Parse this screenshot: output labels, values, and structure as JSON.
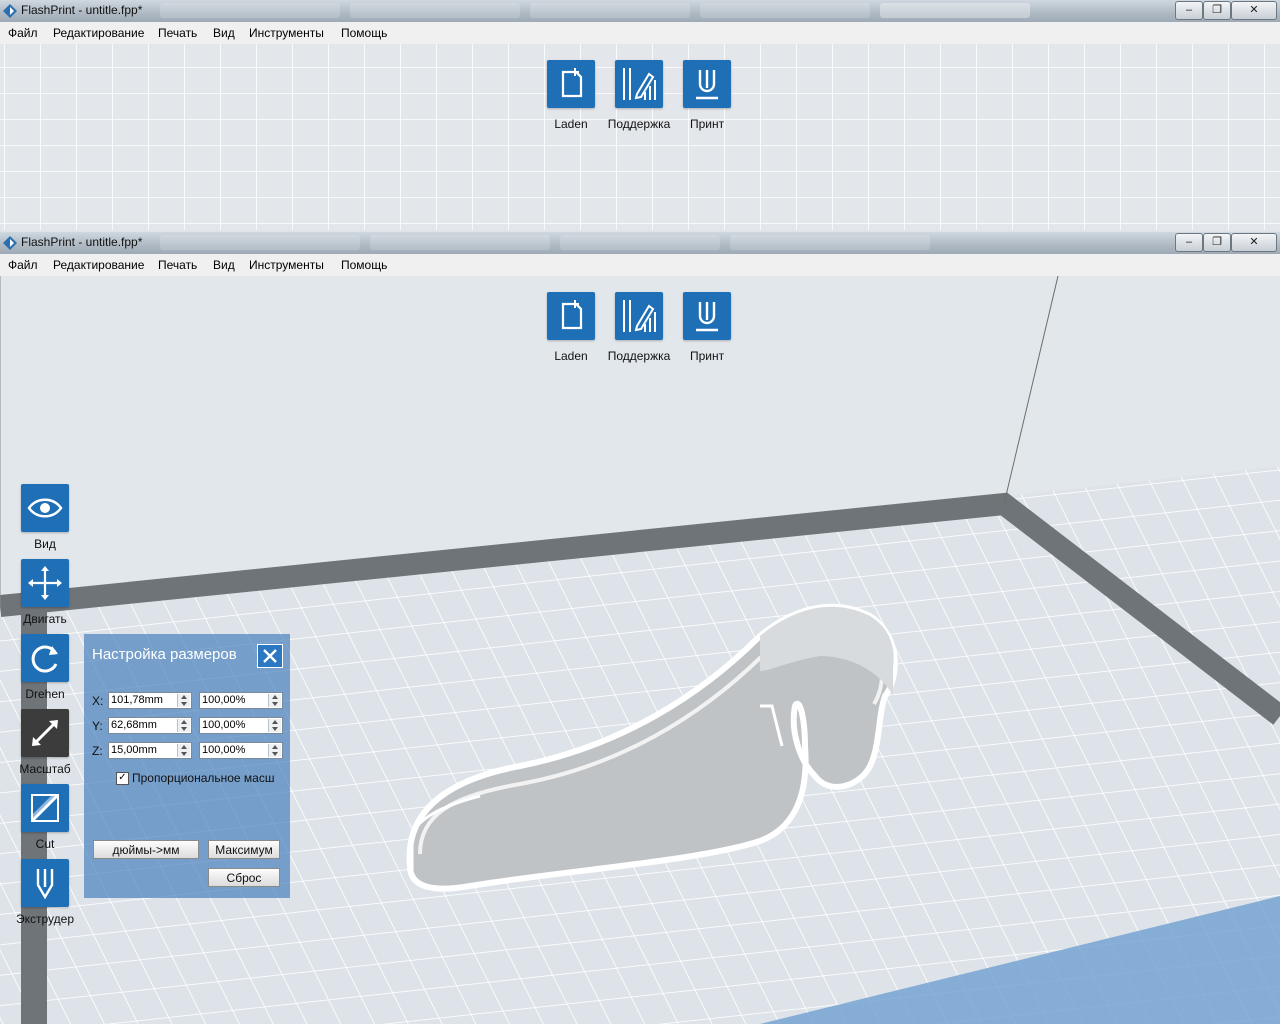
{
  "app": {
    "title": "FlashPrint - untitle.fpp*"
  },
  "window_controls": {
    "minimize": "–",
    "restore": "❐",
    "close": "✕"
  },
  "menu": [
    "Файл",
    "Редактирование",
    "Печать",
    "Вид",
    "Инструменты",
    "Помощь"
  ],
  "toolbar": {
    "load": "Laden",
    "support": "Поддержка",
    "print": "Принт"
  },
  "left_tools": {
    "view": "Вид",
    "move": "Двигать",
    "rotate": "Drehen",
    "scale": "Масштаб",
    "cut": "Cut",
    "extruder": "Экструдер"
  },
  "scale_panel": {
    "title": "Настройка размеров",
    "rows": [
      {
        "axis": "X:",
        "size": "101,78mm",
        "percent": "100,00%"
      },
      {
        "axis": "Y:",
        "size": "62,68mm",
        "percent": "100,00%"
      },
      {
        "axis": "Z:",
        "size": "15,00mm",
        "percent": "100,00%"
      }
    ],
    "proportional": "Пропорциональное масш",
    "inch_to_mm": "дюймы->мм",
    "max": "Максимум",
    "reset": "Сброс"
  },
  "colors": {
    "accent": "#1f6fb6",
    "platform": "#e3e8ec",
    "grid": "#ffffff",
    "frame": "#6d7276"
  }
}
